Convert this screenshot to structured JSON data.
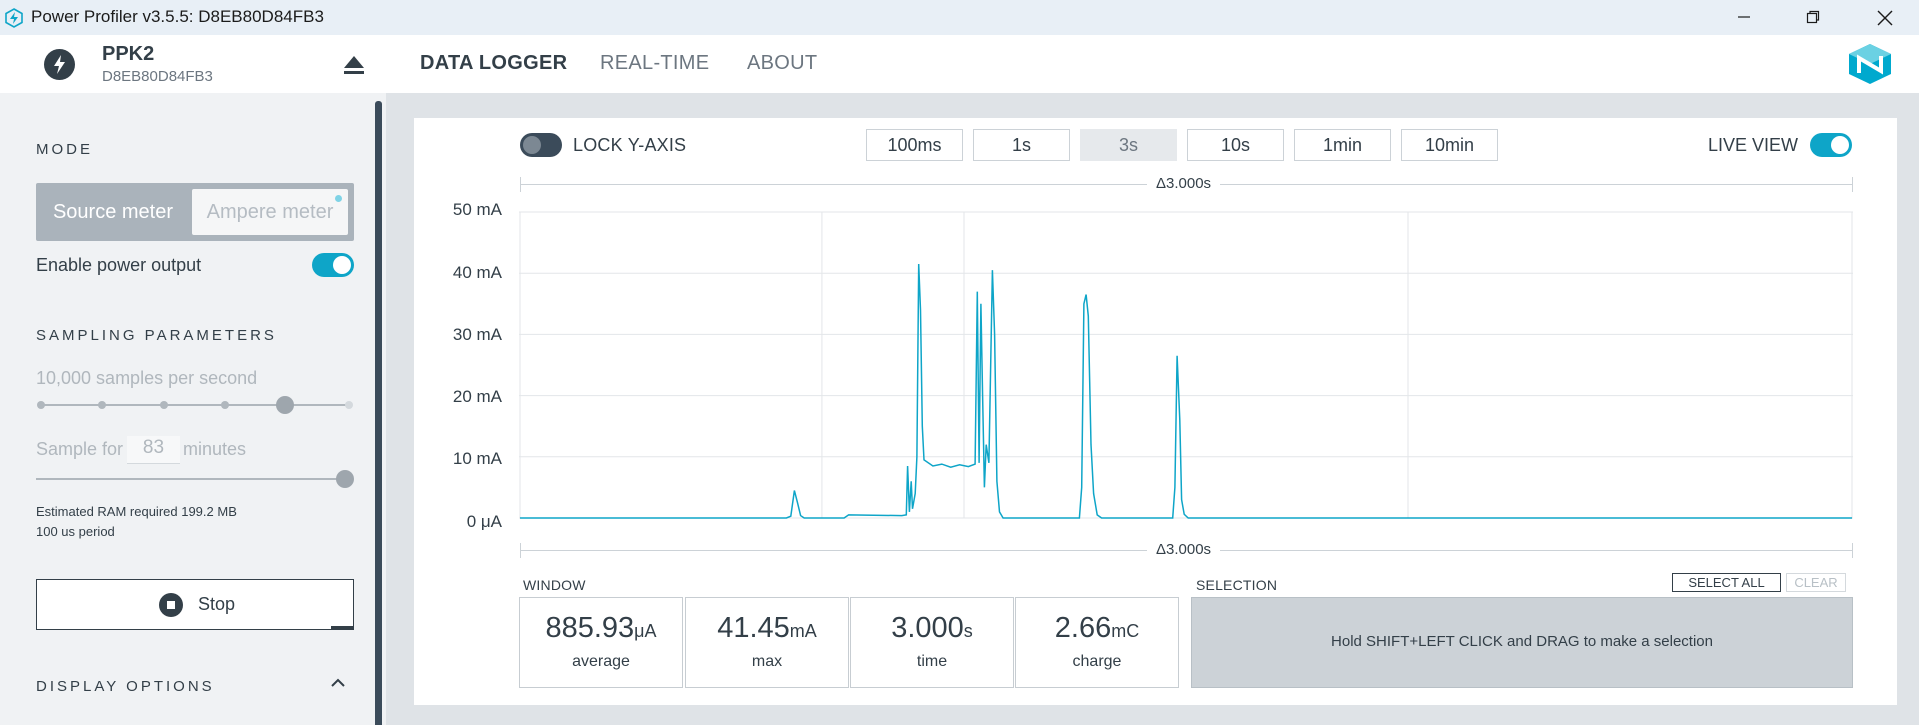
{
  "window": {
    "title": "Power Profiler v3.5.5: D8EB80D84FB3"
  },
  "device": {
    "name": "PPK2",
    "serial": "D8EB80D84FB3"
  },
  "nav": {
    "tabs": [
      "DATA LOGGER",
      "REAL-TIME",
      "ABOUT"
    ],
    "active": "DATA LOGGER"
  },
  "sidebar": {
    "mode_title": "MODE",
    "mode_source": "Source meter",
    "mode_ampere": "Ampere meter",
    "enable_power_label": "Enable power output",
    "enable_power_on": true,
    "sampling_title": "SAMPLING PARAMETERS",
    "samples_label": "10,000 samples per second",
    "sample_for_label": "Sample for",
    "sample_for_value": "83",
    "sample_for_unit": "minutes",
    "ram_info": "Estimated RAM required 199.2 MB",
    "period_info": "100 us period",
    "stop_label": "Stop",
    "display_title": "DISPLAY OPTIONS"
  },
  "toolbar": {
    "lock_y_label": "LOCK Y-AXIS",
    "lock_y_on": false,
    "window_buttons": [
      "100ms",
      "1s",
      "3s",
      "10s",
      "1min",
      "10min"
    ],
    "window_active": "3s",
    "live_view_label": "LIVE VIEW",
    "live_view_on": true
  },
  "chart_data": {
    "type": "line",
    "delta_top": "Δ3.000s",
    "delta_bottom": "Δ3.000s",
    "y_ticks": [
      "50 mA",
      "40 mA",
      "30 mA",
      "20 mA",
      "10 mA",
      "0 μA"
    ],
    "ylim": [
      0,
      50
    ],
    "y_unit": "mA",
    "xlim": [
      0,
      3.0
    ],
    "x_unit": "s",
    "grid": true,
    "color": "#0ea5c8",
    "series": [
      {
        "values": [
          [
            0,
            0
          ],
          [
            0.6,
            0
          ],
          [
            0.61,
            0.3
          ],
          [
            0.618,
            4.5
          ],
          [
            0.625,
            2.5
          ],
          [
            0.632,
            0.4
          ],
          [
            0.64,
            0
          ],
          [
            0.73,
            0
          ],
          [
            0.74,
            0.5
          ],
          [
            0.86,
            0.4
          ],
          [
            0.87,
            0.5
          ],
          [
            0.873,
            8.5
          ],
          [
            0.877,
            1
          ],
          [
            0.881,
            6
          ],
          [
            0.884,
            1.5
          ],
          [
            0.89,
            4
          ],
          [
            0.894,
            10
          ],
          [
            0.898,
            41.5
          ],
          [
            0.902,
            34
          ],
          [
            0.906,
            15
          ],
          [
            0.91,
            9.5
          ],
          [
            0.93,
            8.5
          ],
          [
            0.95,
            8.8
          ],
          [
            0.97,
            8.3
          ],
          [
            0.99,
            8.7
          ],
          [
            1.01,
            8.4
          ],
          [
            1.025,
            8.8
          ],
          [
            1.03,
            37
          ],
          [
            1.034,
            9
          ],
          [
            1.038,
            35
          ],
          [
            1.042,
            20
          ],
          [
            1.046,
            5
          ],
          [
            1.05,
            12
          ],
          [
            1.056,
            9
          ],
          [
            1.064,
            40.5
          ],
          [
            1.069,
            30
          ],
          [
            1.074,
            6
          ],
          [
            1.08,
            1
          ],
          [
            1.088,
            0
          ],
          [
            1.26,
            0
          ],
          [
            1.265,
            5
          ],
          [
            1.27,
            35
          ],
          [
            1.275,
            36.5
          ],
          [
            1.28,
            33
          ],
          [
            1.286,
            12
          ],
          [
            1.292,
            4
          ],
          [
            1.3,
            0.5
          ],
          [
            1.31,
            0
          ],
          [
            1.47,
            0
          ],
          [
            1.475,
            5
          ],
          [
            1.48,
            26.5
          ],
          [
            1.486,
            16
          ],
          [
            1.49,
            3
          ],
          [
            1.496,
            0.6
          ],
          [
            1.505,
            0
          ],
          [
            3.0,
            0
          ]
        ]
      }
    ]
  },
  "window_stats": {
    "title": "WINDOW",
    "items": [
      {
        "value": "885.93",
        "unit": "μA",
        "label": "average"
      },
      {
        "value": "41.45",
        "unit": "mA",
        "label": "max"
      },
      {
        "value": "3.000",
        "unit": "s",
        "label": "time"
      },
      {
        "value": "2.66",
        "unit": "mC",
        "label": "charge"
      }
    ]
  },
  "selection": {
    "title": "SELECTION",
    "select_all": "SELECT ALL",
    "clear": "CLEAR",
    "hint": "Hold SHIFT+LEFT CLICK and DRAG to make a selection"
  }
}
